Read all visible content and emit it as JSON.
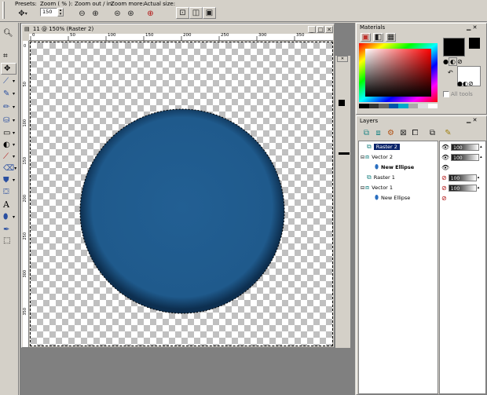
{
  "toolbar": {
    "presets_label": "Presets:",
    "zoom_label": "Zoom ( % ):",
    "zoom_value": "150",
    "zoom_out_in_label": "Zoom out / in:",
    "zoom_more_label": "Zoom more:",
    "actual_size_label": "Actual size:"
  },
  "document": {
    "title": "11 @ 150% (Raster 2)",
    "ruler_ticks": [
      "0",
      "50",
      "100",
      "150",
      "200",
      "250",
      "300",
      "350"
    ],
    "ruler_ticks_vertical": [
      "0",
      "50",
      "100",
      "150",
      "200",
      "250",
      "300",
      "350"
    ],
    "ellipse_color": "#1f5a8c"
  },
  "materials": {
    "title": "Materials",
    "foreground_color": "#000000",
    "background_color": "#ffffff",
    "all_tools_label": "All tools"
  },
  "layers": {
    "title": "Layers",
    "items": [
      {
        "name": "Raster 2",
        "opacity": "100"
      },
      {
        "name": "Vector 2",
        "opacity": "100"
      },
      {
        "name": "New Ellipse",
        "opacity": ""
      },
      {
        "name": "Raster 1",
        "opacity": "100"
      },
      {
        "name": "Vector 1",
        "opacity": "100"
      },
      {
        "name": "New Ellipse",
        "opacity": ""
      }
    ]
  }
}
